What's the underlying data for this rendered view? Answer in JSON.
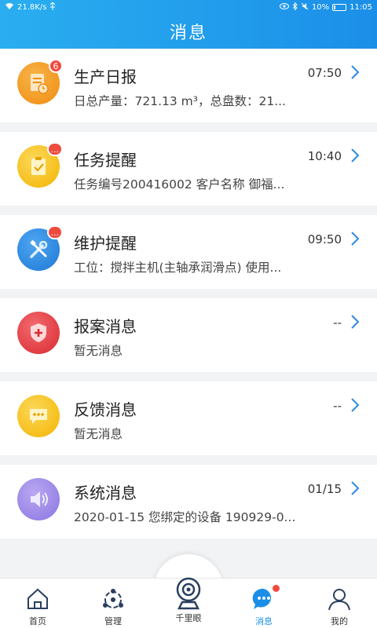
{
  "status_bar": {
    "speed": "21.8K/s",
    "battery": "10%",
    "time": "11:05"
  },
  "header": {
    "title": "消息"
  },
  "messages": [
    {
      "title": "生产日报",
      "time": "07:50",
      "subtitle": "日总产量：721.13 m³，总盘数：21...",
      "badge": "6",
      "icon": "report-icon",
      "color": "#f29b1e"
    },
    {
      "title": "任务提醒",
      "time": "10:40",
      "subtitle": "任务编号200416002 客户名称 御福...",
      "badge": "...",
      "icon": "clipboard-check-icon",
      "color": "#f7c42a"
    },
    {
      "title": "维护提醒",
      "time": "09:50",
      "subtitle": "工位：搅拌主机(主轴承润滑点) 使用...",
      "badge": "...",
      "icon": "tools-icon",
      "color": "#2d8ae6"
    },
    {
      "title": "报案消息",
      "time": "--",
      "subtitle": "暂无消息",
      "badge": "",
      "icon": "shield-plus-icon",
      "color": "#e8383d"
    },
    {
      "title": "反馈消息",
      "time": "--",
      "subtitle": "暂无消息",
      "badge": "",
      "icon": "chat-bubble-icon",
      "color": "#f7c42a"
    },
    {
      "title": "系统消息",
      "time": "01/15",
      "subtitle": "2020-01-15 您绑定的设备 190929-0...",
      "badge": "",
      "icon": "speaker-icon",
      "color": "#9b87e8"
    }
  ],
  "nav": [
    {
      "label": "首页",
      "icon": "home-icon"
    },
    {
      "label": "管理",
      "icon": "network-icon"
    },
    {
      "label": "千里眼",
      "icon": "camera-icon"
    },
    {
      "label": "消息",
      "icon": "message-icon",
      "active": true
    },
    {
      "label": "我的",
      "icon": "user-icon"
    }
  ]
}
